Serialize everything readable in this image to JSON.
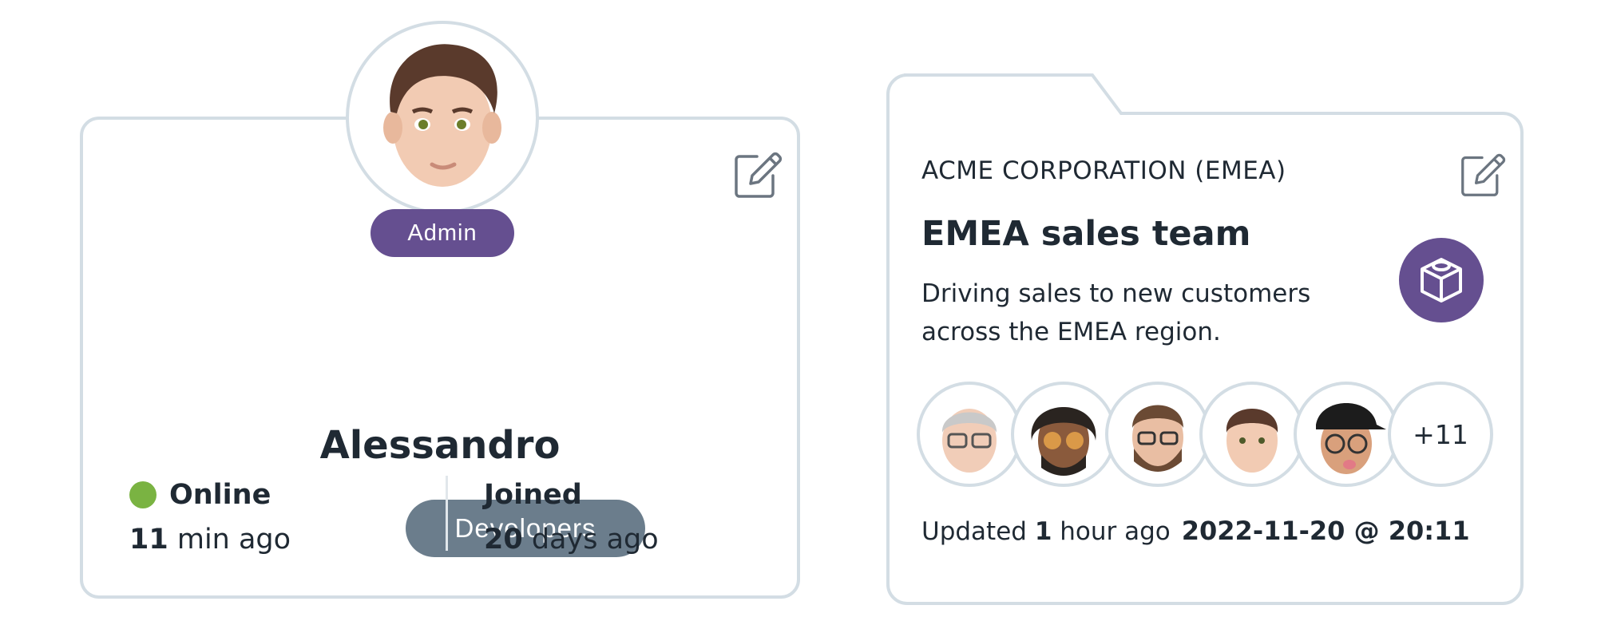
{
  "user_card": {
    "role": "Admin",
    "name": "Alessandro",
    "team": "Developers",
    "status": {
      "label": "Online",
      "value_num": "11",
      "value_text": " min ago",
      "color": "#7ab342"
    },
    "joined": {
      "label": "Joined",
      "value_num": "20",
      "value_text": " days ago"
    }
  },
  "team_card": {
    "org": "ACME CORPORATION (EMEA)",
    "title": "EMEA sales team",
    "description": "Driving sales to new customers across the EMEA region.",
    "icon": "package-icon",
    "members_more": "+11",
    "updated": {
      "prefix": "Updated ",
      "num": "1",
      "suffix": " hour ago",
      "timestamp": "2022-11-20 @ 20:11"
    }
  },
  "colors": {
    "accent": "#654f90",
    "team_pill": "#6b7d8c",
    "border": "#d3dde4"
  }
}
